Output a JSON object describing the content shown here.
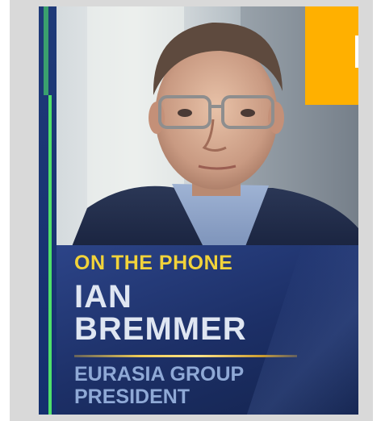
{
  "lower_third": {
    "kicker": "ON THE PHONE",
    "name_first": "IAN",
    "name_last": "BREMMER",
    "title_line1": "EURASIA GROUP",
    "title_line2": "PRESIDENT"
  },
  "colors": {
    "kicker": "#f2d33a",
    "accent_block": "#ffb000",
    "rail_line": "#4fe06a",
    "panel_blue": "#1c2f66"
  }
}
